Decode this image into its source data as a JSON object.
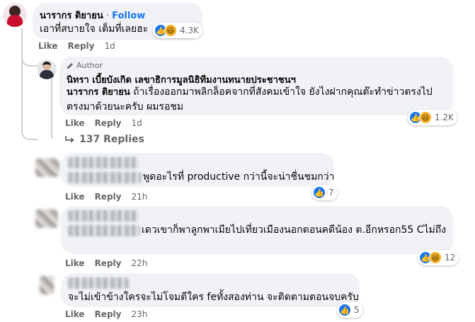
{
  "comments": [
    {
      "author": "นารากร ติยายน",
      "separator": "·",
      "follow_label": "Follow",
      "text": "เอาที่สบายใจ เต็มที่เลยฮะ",
      "reactions": [
        "like",
        "haha"
      ],
      "reaction_count": "4.3K",
      "like_label": "Like",
      "reply_label": "Reply",
      "time": "1d"
    },
    {
      "badge": "Author",
      "author": "นิทรา เบี้ยบังเกิด เลขาธิการมูลนิธิทีมงานทนายประชาชนฯ",
      "mention": "นารากร ติยายน",
      "text": "ถ้าเรื่องออกมาพลิกล็อคจากที่สังคมเข้าใจ ยังไงฝากคุณต๊ะทำข่าวตรงไปตรงมาด้วยนะครับ ผมรอชม",
      "reactions": [
        "like",
        "haha"
      ],
      "reaction_count": "1.2K",
      "like_label": "Like",
      "reply_label": "Reply",
      "time": "1d"
    },
    {
      "text": "พูดอะไรที่ productive กว่านี้จะน่าชื่นชมกว่า",
      "reactions": [
        "like"
      ],
      "reaction_count": "7",
      "like_label": "Like",
      "reply_label": "Reply",
      "time": "21h"
    },
    {
      "text": "เดวเขาก็พาลูกพาเมียไปเที่ยวเมืองนอกตอนคดีน้อง ต.อีกหรอก55 Cไม่ถึง",
      "reactions": [
        "like",
        "haha"
      ],
      "reaction_count": "12",
      "like_label": "Like",
      "reply_label": "Reply",
      "time": "22h"
    },
    {
      "text": "จะไม่เข้าข้างใครจะไม่โจมตีใคร feทั้งสองท่าน จะติดตามตอนจบครับ",
      "reactions": [
        "like"
      ],
      "reaction_count": "5",
      "like_label": "Like",
      "reply_label": "Reply",
      "time": "23h"
    }
  ],
  "replies_toggle": "137 Replies",
  "colors": {
    "link": "#1877f2",
    "bubble": "#f0f2f5",
    "meta": "#65676b",
    "thread": "#ccd0d5"
  },
  "icons": {
    "like": "thumbs-up-icon",
    "haha": "laughing-face-icon",
    "reply_arrow": "reply-arrow-icon",
    "author": "pencil-icon"
  }
}
